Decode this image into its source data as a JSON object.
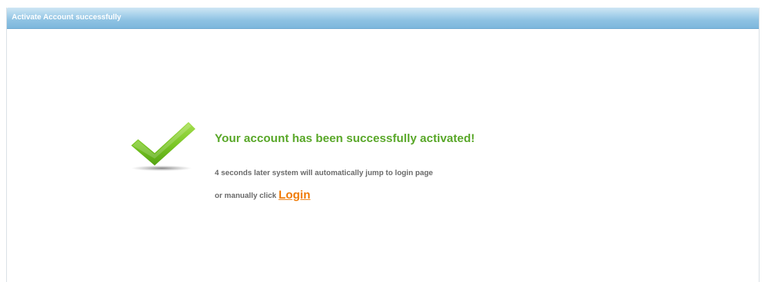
{
  "header": {
    "title": "Activate Account successfully"
  },
  "message": {
    "title": "Your account has been successfully activated!",
    "redirect_text": "4 seconds later system will automatically jump to login page",
    "manual_prefix": "or manually click ",
    "login_label": "Login"
  },
  "icons": {
    "success": "checkmark-icon"
  },
  "colors": {
    "header_blue": "#8fc3e3",
    "success_green": "#5aa82a",
    "link_orange": "#f07d0a",
    "body_text": "#6b6b6b"
  }
}
